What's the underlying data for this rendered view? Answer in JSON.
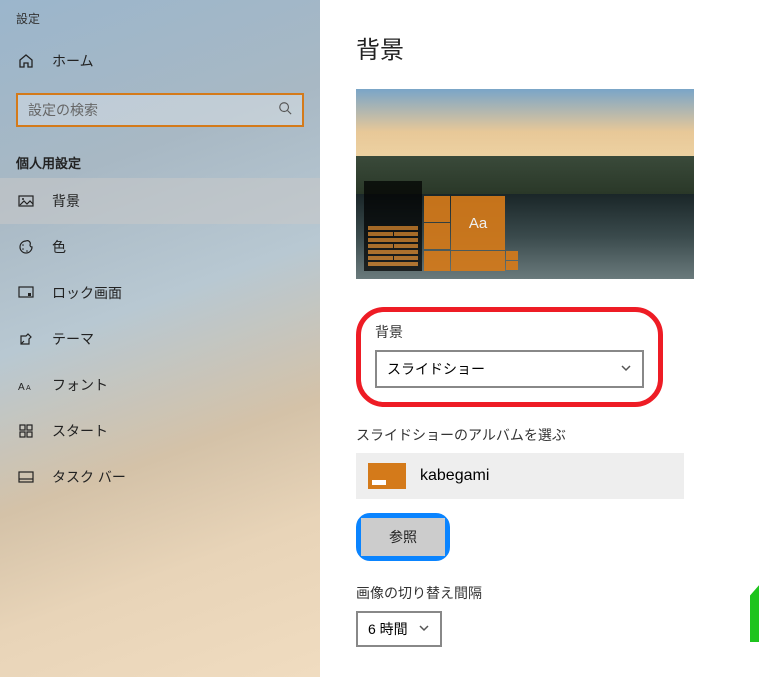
{
  "sidebar": {
    "title": "設定",
    "home_label": "ホーム",
    "search_placeholder": "設定の検索",
    "category_title": "個人用設定",
    "items": [
      {
        "label": "背景"
      },
      {
        "label": "色"
      },
      {
        "label": "ロック画面"
      },
      {
        "label": "テーマ"
      },
      {
        "label": "フォント"
      },
      {
        "label": "スタート"
      },
      {
        "label": "タスク バー"
      }
    ]
  },
  "main": {
    "page_title": "背景",
    "preview_sample": "Aa",
    "background_label": "背景",
    "background_value": "スライドショー",
    "album_label": "スライドショーのアルバムを選ぶ",
    "album_name": "kabegami",
    "browse_label": "参照",
    "interval_label": "画像の切り替え間隔",
    "interval_value": "6 時間"
  }
}
